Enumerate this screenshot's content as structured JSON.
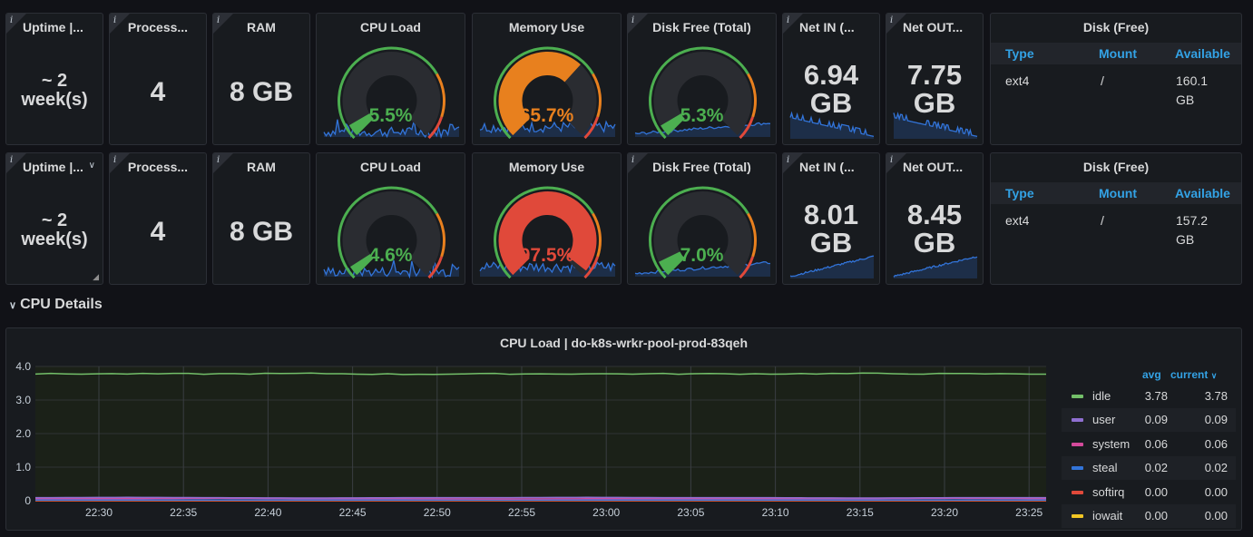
{
  "rows": [
    {
      "uptime": {
        "title": "Uptime |...",
        "value_num": "~ 2",
        "value_unit": "week(s)"
      },
      "processors": {
        "title": "Process...",
        "value": "4"
      },
      "ram": {
        "title": "RAM",
        "value": "8 GB"
      },
      "cpu_load": {
        "title": "CPU Load",
        "value": "5.5%",
        "percent": 5.5,
        "color": "#4caf50"
      },
      "memory_use": {
        "title": "Memory Use",
        "value": "65.7%",
        "percent": 65.7,
        "color": "#e8801e"
      },
      "disk_free": {
        "title": "Disk Free (Total)",
        "value": "5.3%",
        "percent": 5.3,
        "color": "#4caf50"
      },
      "net_in": {
        "title": "Net IN (...",
        "value_num": "6.94",
        "value_unit": "GB"
      },
      "net_out": {
        "title": "Net OUT...",
        "value_num": "7.75",
        "value_unit": "GB"
      },
      "disk_table": {
        "title": "Disk (Free)",
        "headers": [
          "Type",
          "Mount",
          "Available"
        ],
        "row": {
          "type": "ext4",
          "mount": "/",
          "available_num": "160.1",
          "available_unit": "GB"
        }
      }
    },
    {
      "uptime": {
        "title": "Uptime |...",
        "value_num": "~ 2",
        "value_unit": "week(s)"
      },
      "processors": {
        "title": "Process...",
        "value": "4"
      },
      "ram": {
        "title": "RAM",
        "value": "8 GB"
      },
      "cpu_load": {
        "title": "CPU Load",
        "value": "4.6%",
        "percent": 4.6,
        "color": "#4caf50"
      },
      "memory_use": {
        "title": "Memory Use",
        "value": "97.5%",
        "percent": 97.5,
        "color": "#e0493a"
      },
      "disk_free": {
        "title": "Disk Free (Total)",
        "value": "7.0%",
        "percent": 7.0,
        "color": "#4caf50"
      },
      "net_in": {
        "title": "Net IN (...",
        "value_num": "8.01",
        "value_unit": "GB"
      },
      "net_out": {
        "title": "Net OUT...",
        "value_num": "8.45",
        "value_unit": "GB"
      },
      "disk_table": {
        "title": "Disk (Free)",
        "headers": [
          "Type",
          "Mount",
          "Available"
        ],
        "row": {
          "type": "ext4",
          "mount": "/",
          "available_num": "157.2",
          "available_unit": "GB"
        }
      }
    }
  ],
  "section": {
    "title": "CPU Details"
  },
  "chart_data": {
    "type": "line",
    "title": "CPU Load | do-k8s-wrkr-pool-prod-83qeh",
    "xlabel": "",
    "ylabel": "",
    "ylim": [
      0,
      4.0
    ],
    "yticks": [
      "0",
      "1.0",
      "2.0",
      "3.0",
      "4.0"
    ],
    "x": [
      "22:30",
      "22:35",
      "22:40",
      "22:45",
      "22:50",
      "22:55",
      "23:00",
      "23:05",
      "23:10",
      "23:15",
      "23:20",
      "23:25"
    ],
    "grid": true,
    "legend_placement": "right",
    "legend_headers": {
      "avg": "avg",
      "current": "current"
    },
    "series": [
      {
        "name": "idle",
        "color": "#73bf69",
        "avg": "3.78",
        "current": "3.78",
        "values": [
          3.78,
          3.78,
          3.78,
          3.79,
          3.77,
          3.78,
          3.78,
          3.78,
          3.78,
          3.79,
          3.78,
          3.78
        ]
      },
      {
        "name": "user",
        "color": "#8f6fd1",
        "avg": "0.09",
        "current": "0.09",
        "values": [
          0.09,
          0.1,
          0.09,
          0.08,
          0.09,
          0.09,
          0.1,
          0.09,
          0.09,
          0.08,
          0.09,
          0.09
        ]
      },
      {
        "name": "system",
        "color": "#d44a9b",
        "avg": "0.06",
        "current": "0.06",
        "values": [
          0.06,
          0.06,
          0.07,
          0.06,
          0.06,
          0.05,
          0.06,
          0.06,
          0.06,
          0.06,
          0.07,
          0.06
        ]
      },
      {
        "name": "steal",
        "color": "#3274d9",
        "avg": "0.02",
        "current": "0.02",
        "values": [
          0.02,
          0.02,
          0.02,
          0.02,
          0.02,
          0.02,
          0.02,
          0.02,
          0.02,
          0.02,
          0.02,
          0.02
        ]
      },
      {
        "name": "softirq",
        "color": "#e0493a",
        "avg": "0.00",
        "current": "0.00",
        "values": [
          0,
          0,
          0,
          0,
          0,
          0,
          0,
          0,
          0,
          0,
          0,
          0
        ]
      },
      {
        "name": "iowait",
        "color": "#f2c624",
        "avg": "0.00",
        "current": "0.00",
        "values": [
          0,
          0,
          0,
          0,
          0,
          0,
          0,
          0,
          0,
          0,
          0,
          0
        ]
      }
    ]
  }
}
